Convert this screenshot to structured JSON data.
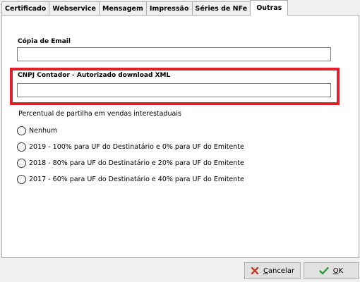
{
  "tabs": [
    {
      "label": "Certificado"
    },
    {
      "label": "Webservice"
    },
    {
      "label": "Mensagem"
    },
    {
      "label": "Impressão"
    },
    {
      "label": "Séries de NFe"
    },
    {
      "label": "Outras",
      "active": true
    }
  ],
  "email": {
    "label": "Cópia de  Email",
    "value": ""
  },
  "cnpj": {
    "label": "CNPJ Contador - Autorizado download XML",
    "value": ""
  },
  "partilha": {
    "label": "Percentual de partilha em vendas interestaduais",
    "options": [
      {
        "label": "Nenhum"
      },
      {
        "label": "2019 - 100% para UF do Destinatário e 0% para UF do Emitente"
      },
      {
        "label": "2018 - 80% para UF do Destinatário e 20% para UF do Emitente"
      },
      {
        "label": "2017 - 60% para UF do Destinatário e 40% para UF do Emitente"
      }
    ]
  },
  "buttons": {
    "cancel_prefix": "",
    "cancel_underline": "C",
    "cancel_rest": "ancelar",
    "ok_underline": "O",
    "ok_rest": "K"
  },
  "colors": {
    "highlight": "#e0202a",
    "cancel_icon": "#c0392b",
    "ok_icon": "#2e9e3c"
  },
  "icons": {
    "cancel": "x-icon",
    "ok": "checkmark-icon"
  }
}
